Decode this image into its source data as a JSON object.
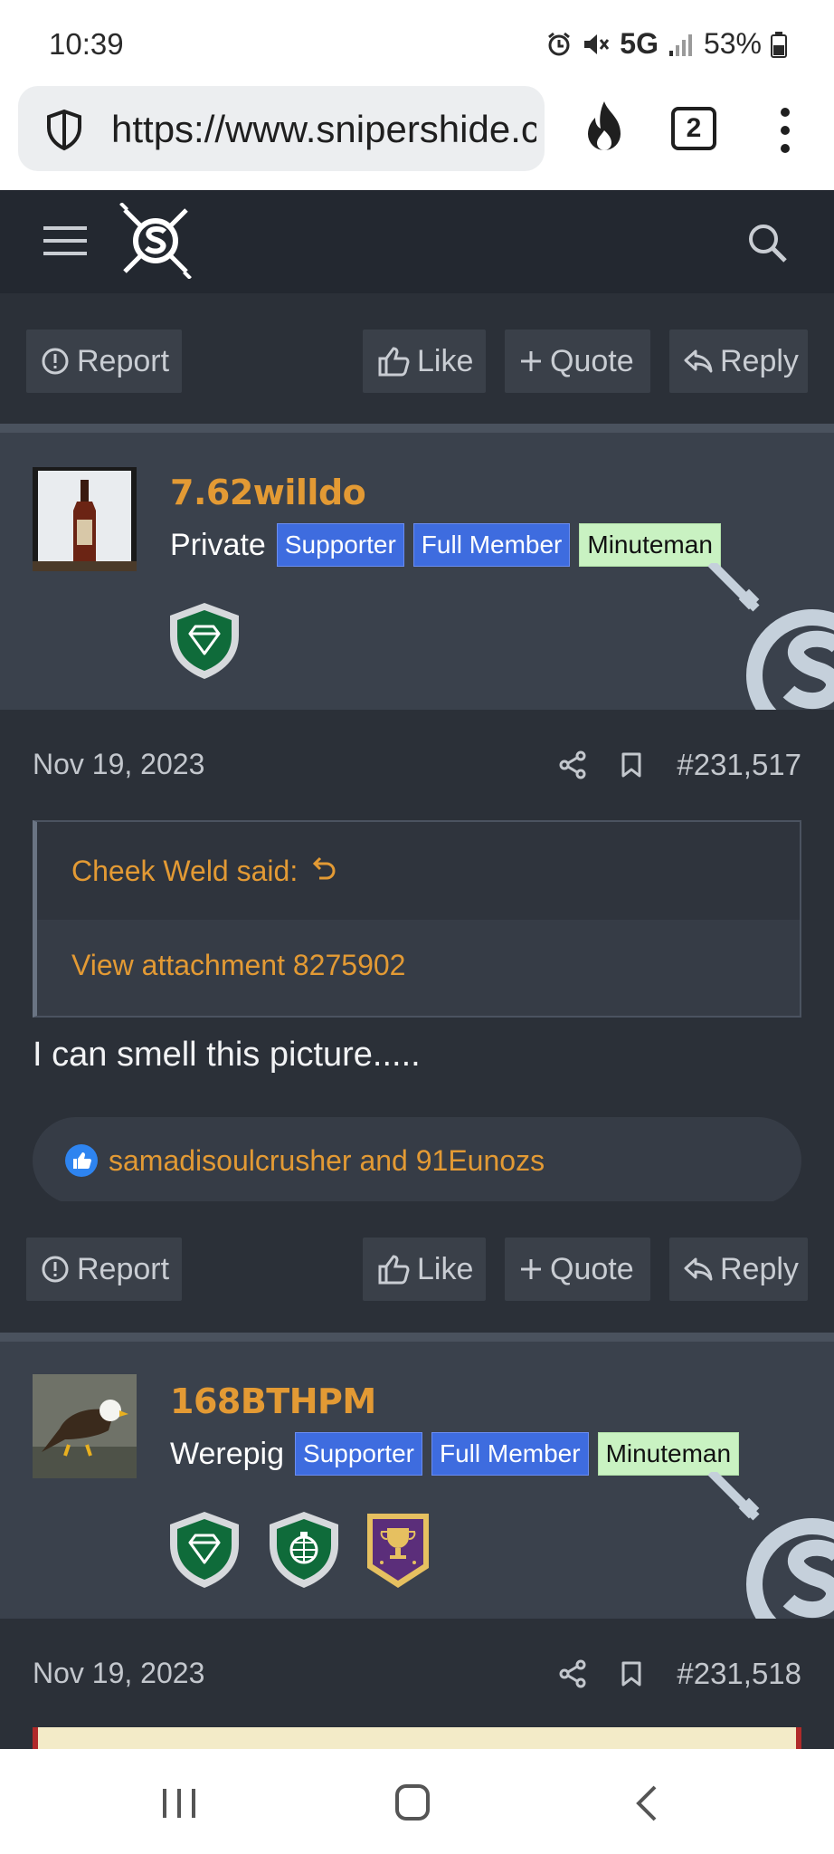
{
  "status_bar": {
    "time": "10:39",
    "network": "5G",
    "battery": "53%",
    "icons": [
      "alarm-icon",
      "mute-icon",
      "signal-icon",
      "battery-icon"
    ]
  },
  "browser": {
    "url": "https://www.snipershide.com",
    "tab_count": "2",
    "icons": [
      "shield-icon",
      "fire-icon",
      "tabs-icon",
      "overflow-menu-icon"
    ]
  },
  "site_header": {
    "icons": [
      "hamburger-menu-icon",
      "site-logo",
      "search-icon"
    ]
  },
  "actions": {
    "report": "Report",
    "like": "Like",
    "quote": "Quote",
    "reply": "Reply"
  },
  "posts": [
    {
      "username": "7.62willdo",
      "rank": "Private",
      "badges": [
        "Supporter",
        "Full Member",
        "Minuteman"
      ],
      "trophies": [
        "diamond-trophy-icon"
      ],
      "date": "Nov 19, 2023",
      "number": "#231,517",
      "quote_author": "Cheek Weld said:",
      "quote_text": "View attachment 8275902",
      "body": "I can smell this picture.....",
      "reactions": "samadisoulcrusher and 91Eunozs"
    },
    {
      "username": "168BTHPM",
      "rank": "Werepig",
      "badges": [
        "Supporter",
        "Full Member",
        "Minuteman"
      ],
      "trophies": [
        "diamond-trophy-icon",
        "grenade-globe-trophy-icon",
        "cup-trophy-icon"
      ],
      "date": "Nov 19, 2023",
      "number": "#231,518"
    }
  ],
  "colors": {
    "accent": "#e39a34",
    "badge_blue": "#3e6cdf",
    "badge_green": "#c9f2c2",
    "background": "#2b3038",
    "user_block": "#3a414c"
  }
}
